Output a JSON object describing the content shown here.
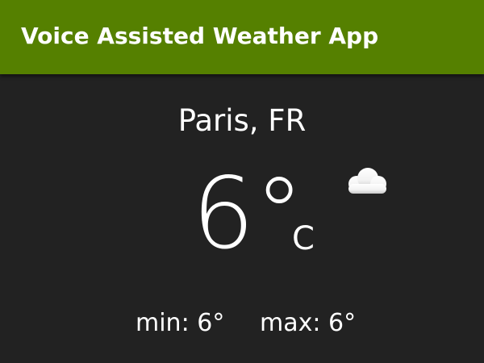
{
  "app": {
    "title": "Voice Assisted Weather App"
  },
  "weather": {
    "location": "Paris, FR",
    "temperature": "6°",
    "unit": "C",
    "condition_icon": "cloud-icon",
    "min_label": "min:",
    "min_value": "6°",
    "max_label": "max:",
    "max_value": "6°"
  },
  "colors": {
    "app_bar": "#558000",
    "background": "#222222",
    "text": "#ffffff"
  }
}
